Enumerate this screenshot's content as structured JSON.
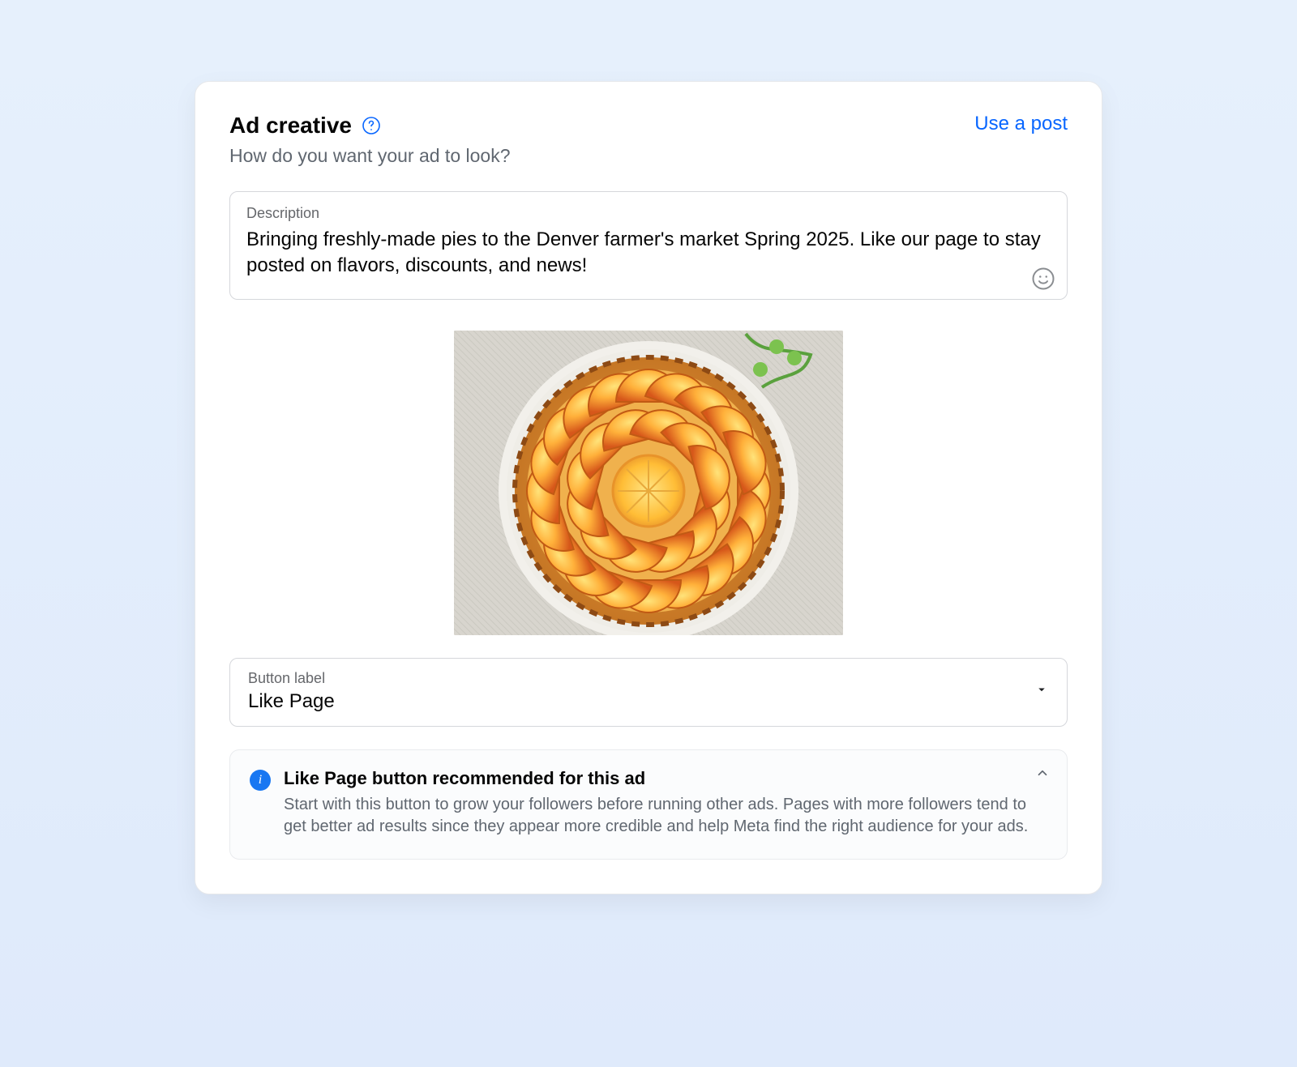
{
  "header": {
    "title": "Ad creative",
    "help_icon": "help-icon",
    "use_post_label": "Use a post",
    "subtitle": "How do you want your ad to look?"
  },
  "description": {
    "label": "Description",
    "value": "Bringing freshly-made pies to the Denver farmer's market Spring 2025. Like our page to stay posted on flavors, discounts, and news!",
    "emoji_icon": "emoji-icon"
  },
  "image": {
    "alt": "Orange tart pie on white plate"
  },
  "button_select": {
    "label": "Button label",
    "selected": "Like Page"
  },
  "info": {
    "title": "Like Page button recommended for this ad",
    "description": "Start with this button to grow your followers before running other ads. Pages with more followers tend to get better ad results since they appear more credible and help Meta find the right audience for your ads."
  }
}
